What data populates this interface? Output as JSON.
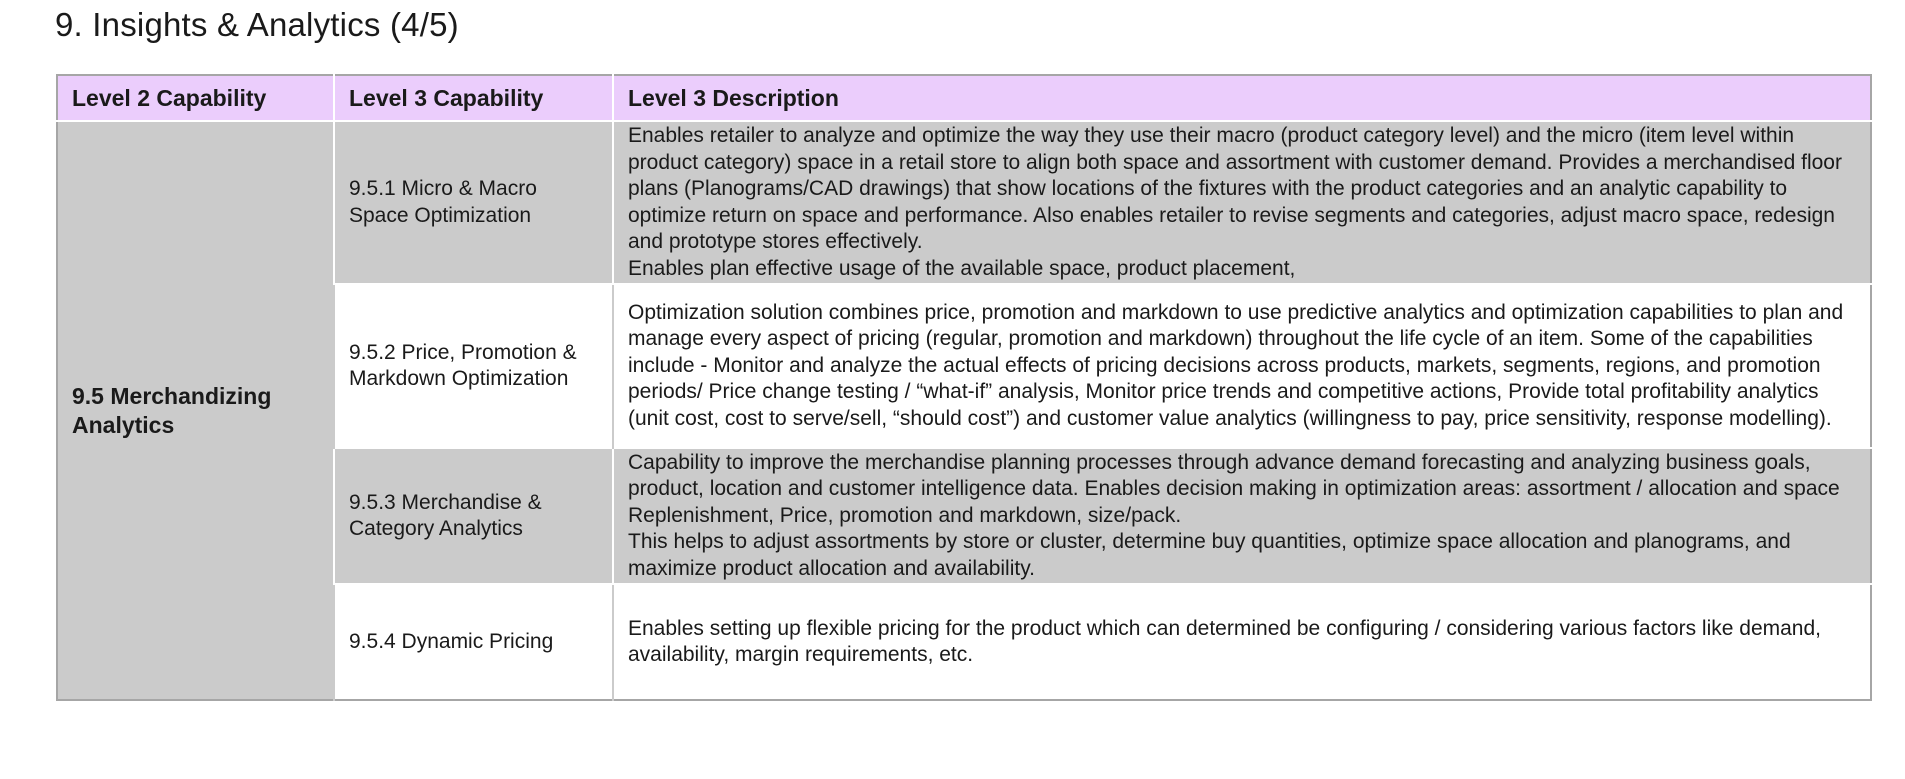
{
  "page": {
    "title": "9. Insights & Analytics (4/5)"
  },
  "table": {
    "headers": [
      "Level 2 Capability",
      "Level 3 Capability",
      "Level 3 Description"
    ],
    "level2_capability": "9.5 Merchandizing Analytics",
    "rows": [
      {
        "level3": "9.5.1 Micro & Macro Space Optimization",
        "description": [
          "Enables retailer to analyze and optimize the way they use their macro (product category level) and the micro (item level within product category) space in a retail store to align both space and assortment with customer demand. Provides a merchandised floor plans (Planograms/CAD drawings) that show locations of the fixtures with the product categories and an analytic capability to optimize return on space and performance. Also enables retailer to revise segments and categories, adjust macro space, redesign and prototype stores effectively.",
          "Enables plan effective usage of the available space, product placement,"
        ]
      },
      {
        "level3": "9.5.2 Price, Promotion & Markdown Optimization",
        "description": [
          "Optimization solution combines price, promotion and markdown to use predictive analytics and optimization capabilities to plan and manage every aspect of pricing (regular, promotion and markdown) throughout the life cycle of an item. Some of the capabilities include - Monitor and analyze the actual effects of pricing decisions across products, markets, segments, regions, and promotion periods/ Price change testing / “what-if” analysis, Monitor price trends and competitive actions, Provide total profitability analytics (unit cost, cost to serve/sell, “should cost”) and customer value analytics (willingness to pay, price sensitivity, response modelling)."
        ]
      },
      {
        "level3": "9.5.3 Merchandise & Category Analytics",
        "description": [
          "Capability to improve the merchandise planning processes through advance demand forecasting and analyzing business goals, product, location and customer intelligence data. Enables decision making in optimization areas: assortment / allocation and space Replenishment, Price, promotion and markdown, size/pack.",
          "This helps to adjust assortments by store or cluster, determine buy quantities, optimize space allocation and planograms, and maximize product allocation and availability."
        ]
      },
      {
        "level3": "9.5.4 Dynamic Pricing",
        "description": [
          "Enables setting up flexible pricing for the product which can determined be configuring / considering various factors like demand, availability, margin requirements, etc."
        ]
      }
    ]
  },
  "colors": {
    "header_bg": "#ebcdfc",
    "shaded_bg": "#cbcbcb",
    "border": "#a6a6a6"
  }
}
